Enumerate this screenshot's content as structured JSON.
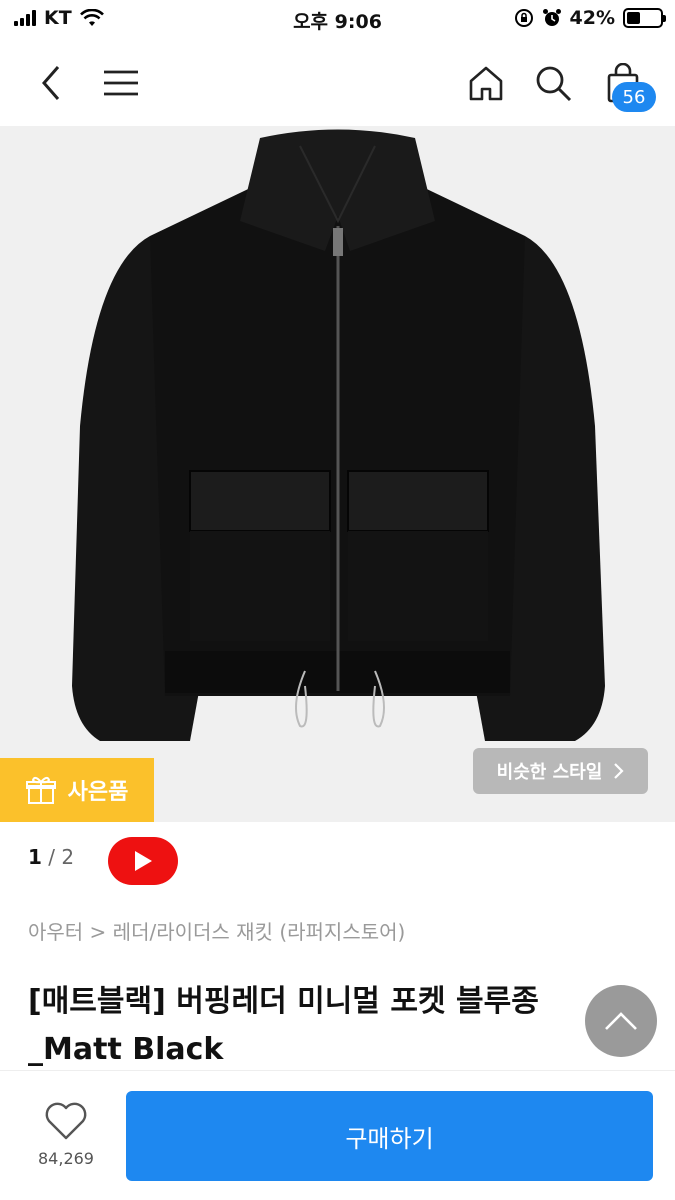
{
  "status_bar": {
    "carrier": "KT",
    "time": "오후 9:06",
    "battery": "42%",
    "battery_level": 0.42
  },
  "nav": {
    "back_icon": "chevron-left-icon",
    "menu_icon": "hamburger-menu-icon",
    "home_icon": "home-icon",
    "search_icon": "search-icon",
    "cart_icon": "shopping-bag-icon",
    "cart_count": "56"
  },
  "gallery": {
    "gift_label": "사은품",
    "similar_label": "비슷한 스타일",
    "current_page": "1",
    "separator": "/",
    "total_pages": "2"
  },
  "product": {
    "breadcrumb": "아우터 > 레더/라이더스 재킷 (라퍼지스토어)",
    "title": "[매트블랙] 버핑레더 미니멀 포켓 블루종_Matt Black"
  },
  "bottom_bar": {
    "like_count": "84,269",
    "buy_label": "구매하기"
  },
  "colors": {
    "accent": "#1e88f0",
    "gift": "#fbc12b",
    "youtube": "#ee1111"
  }
}
